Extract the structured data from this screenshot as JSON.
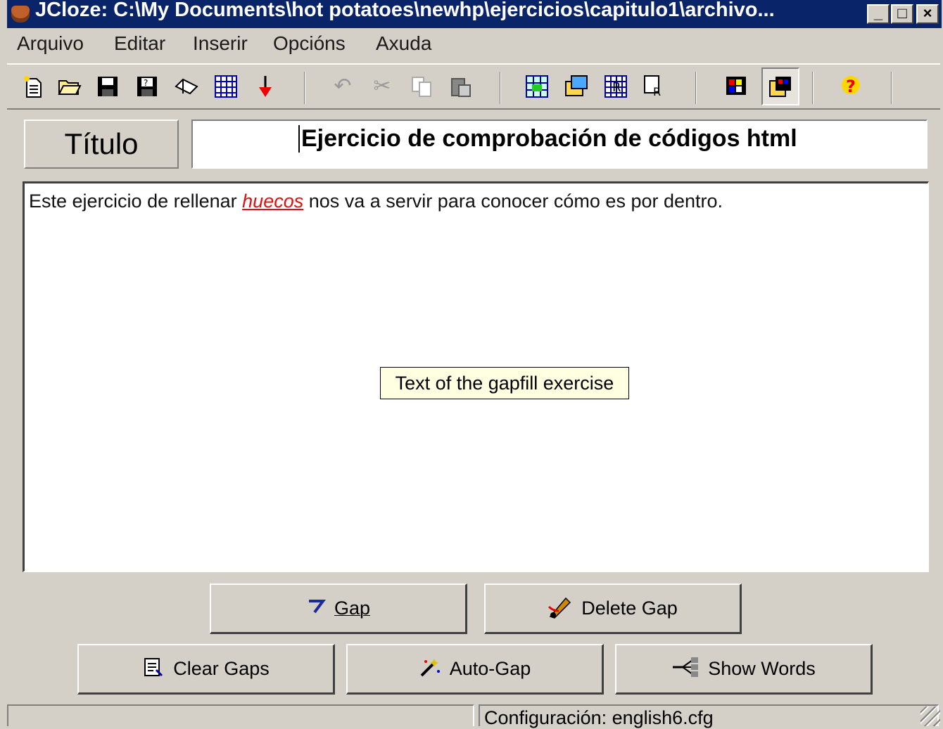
{
  "window": {
    "title": "JCloze: C:\\My Documents\\hot potatoes\\newhp\\ejercicios\\capitulo1\\archivo...",
    "caption_buttons": [
      "_",
      "□",
      "×"
    ]
  },
  "menu": [
    "Arquivo",
    "Editar",
    "Inserir",
    "Opcións",
    "Axuda"
  ],
  "toolbar": {
    "icons": [
      "new-file-icon",
      "open-folder-icon",
      "save-icon",
      "save-as-icon",
      "clear-eraser-icon",
      "web-page-icon",
      "export-arrow-icon",
      "undo-icon",
      "cut-icon",
      "copy-icon",
      "paste-icon",
      "config-icon-1",
      "config-icon-2",
      "config-icon-3",
      "config-icon-4",
      "palette-icon-1",
      "palette-icon-2",
      "help-icon"
    ]
  },
  "title_field": {
    "label": "Título",
    "value": "Ejercicio de comprobación de códigos html"
  },
  "exercise": {
    "before": "Este ejercicio de rellenar ",
    "gap_word": "huecos",
    "after": " nos va a servir para conocer cómo es por dentro."
  },
  "tooltip": "Text of the gapfill exercise",
  "buttons": {
    "gap": "Gap",
    "delete_gap": "Delete Gap",
    "clear_gaps": "Clear Gaps",
    "auto_gap": "Auto-Gap",
    "show_words": "Show Words"
  },
  "status": {
    "config": "Configuración: english6.cfg"
  }
}
